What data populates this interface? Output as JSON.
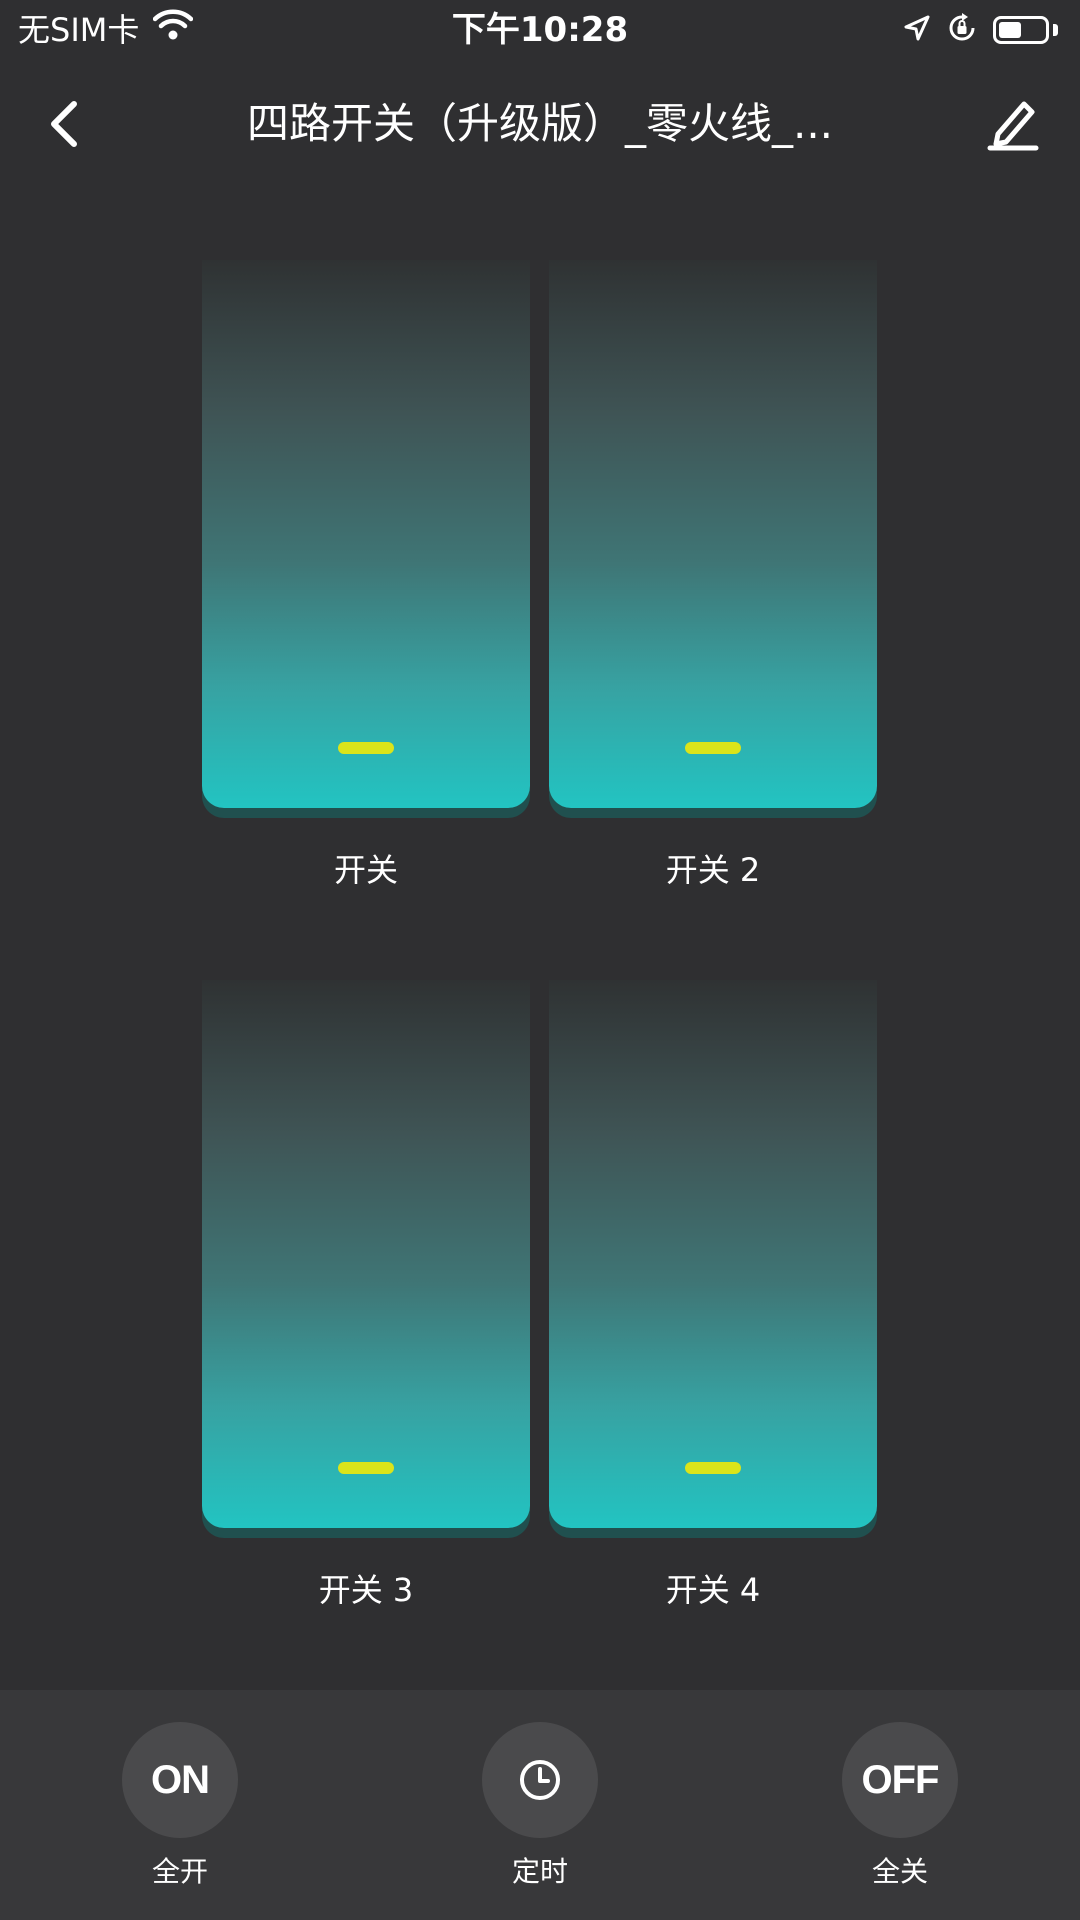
{
  "status_bar": {
    "carrier": "无SIM卡",
    "time": "下午10:28"
  },
  "nav": {
    "title": "四路开关（升级版）_零火线_..."
  },
  "switches": [
    {
      "label": "开关",
      "indicator_color": "#dbe41a"
    },
    {
      "label": "开关 2",
      "indicator_color": "#dbe41a"
    },
    {
      "label": "开关 3",
      "indicator_color": "#dbe41a"
    },
    {
      "label": "开关 4",
      "indicator_color": "#dbe41a"
    }
  ],
  "bottom_actions": {
    "all_on": {
      "icon_text": "ON",
      "label": "全开"
    },
    "timer": {
      "icon": "clock-icon",
      "label": "定时"
    },
    "all_off": {
      "icon_text": "OFF",
      "label": "全关"
    }
  },
  "colors": {
    "background": "#2f2f31",
    "switch_gradient_bottom": "#22c4c2",
    "indicator": "#dbe41a",
    "bottom_bar": "#38383a"
  }
}
